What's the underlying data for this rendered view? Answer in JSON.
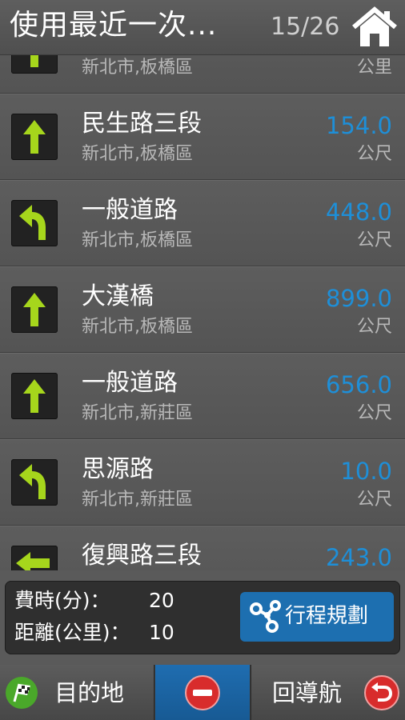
{
  "header": {
    "title": "使用最近一次...",
    "counter": "15/26"
  },
  "rows": [
    {
      "road": "",
      "city": "新北市,板橋區",
      "distance": "",
      "unit": "公里",
      "turn": "straight-arrow-icon"
    },
    {
      "road": "民生路三段",
      "city": "新北市,板橋區",
      "distance": "154.0",
      "unit": "公尺",
      "turn": "straight-arrow-icon"
    },
    {
      "road": "一般道路",
      "city": "新北市,板橋區",
      "distance": "448.0",
      "unit": "公尺",
      "turn": "turn-left-arrow-icon"
    },
    {
      "road": "大漢橋",
      "city": "新北市,板橋區",
      "distance": "899.0",
      "unit": "公尺",
      "turn": "straight-arrow-icon"
    },
    {
      "road": "一般道路",
      "city": "新北市,新莊區",
      "distance": "656.0",
      "unit": "公尺",
      "turn": "straight-arrow-icon"
    },
    {
      "road": "思源路",
      "city": "新北市,新莊區",
      "distance": "10.0",
      "unit": "公尺",
      "turn": "turn-left-arrow-icon"
    },
    {
      "road": "復興路三段",
      "city": "",
      "distance": "243.0",
      "unit": "",
      "turn": "turn-left-arrow-icon"
    }
  ],
  "summary": {
    "time_label": "費時(分)：",
    "time_value": "20",
    "distance_label": "距離(公里)：",
    "distance_value": "10",
    "plan_button": "行程規劃"
  },
  "bottom_bar": {
    "destination": "目的地",
    "back_to_nav": "回導航"
  },
  "colors": {
    "arrow": "#a6d61c",
    "distance": "#1e8fd8",
    "accent_blue": "#1d6fb0",
    "cancel_red": "#d82c2c"
  }
}
